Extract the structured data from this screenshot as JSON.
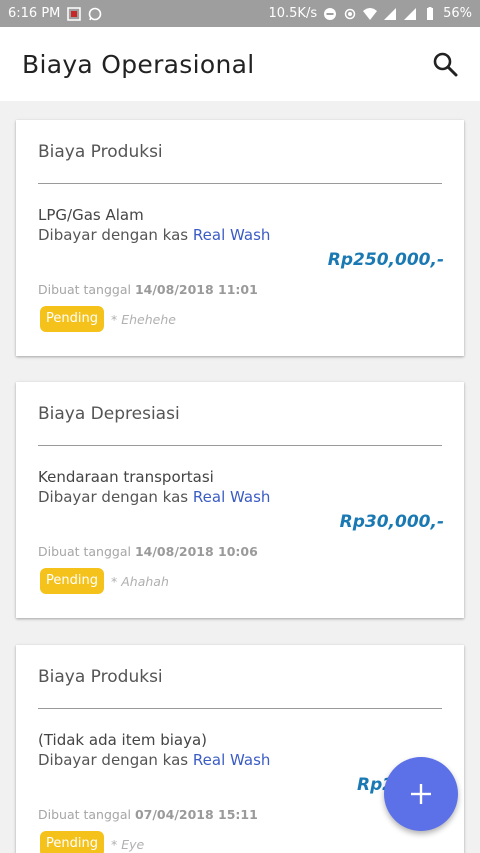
{
  "status": {
    "time": "6:16 PM",
    "net_speed": "10.5K/s",
    "battery": "56%"
  },
  "appbar": {
    "title": "Biaya Operasional",
    "search_icon": "search-icon"
  },
  "cards": [
    {
      "title": "Biaya Produksi",
      "item": "LPG/Gas Alam",
      "paid_prefix": "Dibayar dengan kas",
      "account": "Real Wash",
      "amount": "Rp250,000,-",
      "created_label": "Dibuat tanggal",
      "created_date": "14/08/2018 11:01",
      "status": "Pending",
      "note": "* Ehehehe"
    },
    {
      "title": "Biaya Depresiasi",
      "item": "Kendaraan transportasi",
      "paid_prefix": "Dibayar dengan kas",
      "account": "Real Wash",
      "amount": "Rp30,000,-",
      "created_label": "Dibuat tanggal",
      "created_date": "14/08/2018 10:06",
      "status": "Pending",
      "note": "* Ahahah"
    },
    {
      "title": "Biaya Produksi",
      "item": "(Tidak ada item biaya)",
      "paid_prefix": "Dibayar dengan kas",
      "account": "Real Wash",
      "amount": "Rp2",
      "created_label": "Dibuat tanggal",
      "created_date": "07/04/2018 15:11",
      "status": "Pending",
      "note": "* Eye"
    }
  ],
  "fab": {
    "icon": "plus-icon"
  },
  "colors": {
    "accent": "#5c70e8",
    "amount": "#1a79b3",
    "account_link": "#3b5cc4",
    "pending_badge": "#f5c21b"
  }
}
